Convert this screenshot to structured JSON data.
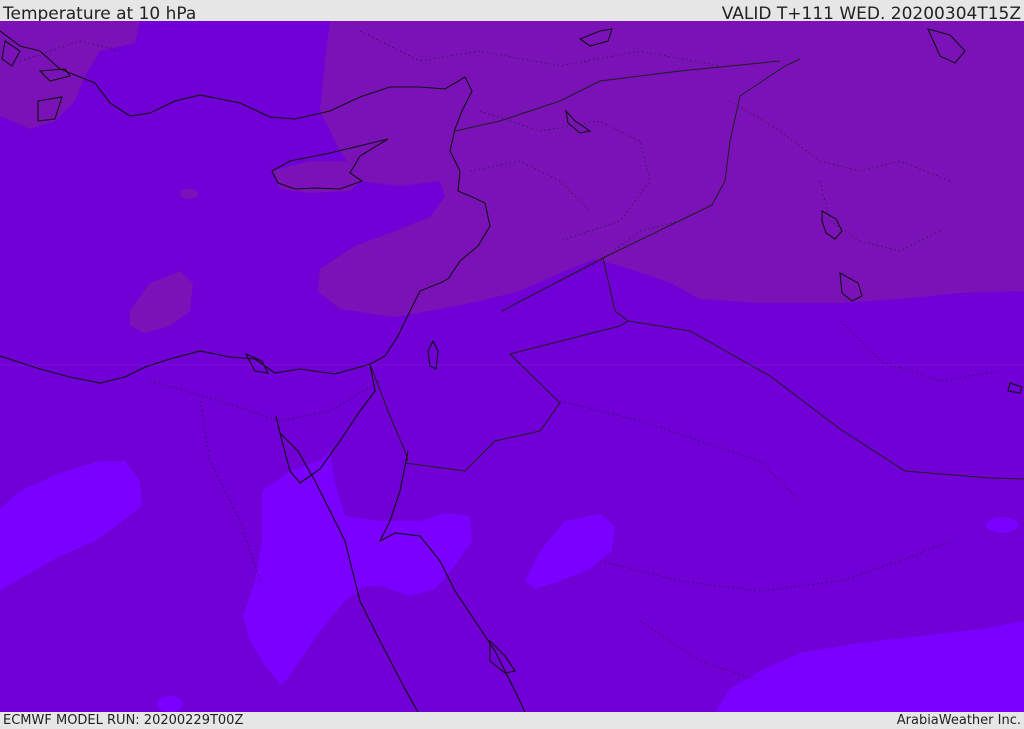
{
  "header": {
    "title": "Temperature at 10 hPa",
    "valid": "VALID T+111 WED. 20200304T15Z"
  },
  "footer": {
    "model_run": "ECMWF MODEL RUN: 20200229T00Z",
    "credit": "ArabiaWeather Inc."
  },
  "map": {
    "colors": {
      "base": "#7000d6",
      "warm": "#7a12b8",
      "cool": "#7a00ff",
      "coast": "#111111",
      "border": "#222222"
    }
  }
}
